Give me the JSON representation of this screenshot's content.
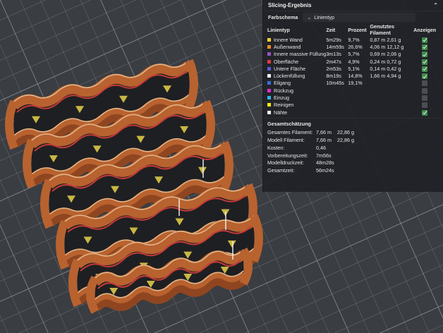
{
  "panel": {
    "title": "Slicing-Ergebnis",
    "color_scheme_label": "Farbschema",
    "color_scheme_value": "Linientyp",
    "headers": [
      "Linientyp",
      "Zeit",
      "Prozent",
      "Genutztes Filament",
      "Anzeigen"
    ],
    "rows": [
      {
        "name": "Innere Wand",
        "time": "5m29s",
        "percent": "9,7%",
        "len": "0,87 m",
        "weight": "2,61 g",
        "color": "#f2d22e",
        "visible": true
      },
      {
        "name": "Außenwand",
        "time": "14m59s",
        "percent": "26,6%",
        "len": "4,06 m",
        "weight": "12,12 g",
        "color": "#f28a2a",
        "visible": true
      },
      {
        "name": "Innere massive Füllung",
        "time": "3m13s",
        "percent": "5,7%",
        "len": "0,69 m",
        "weight": "2,06 g",
        "color": "#9a4fc9",
        "visible": true
      },
      {
        "name": "Oberfläche",
        "time": "2m47s",
        "percent": "4,9%",
        "len": "0,24 m",
        "weight": "0,72 g",
        "color": "#e33a3a",
        "visible": true
      },
      {
        "name": "Untere Fläche",
        "time": "2m53s",
        "percent": "5,1%",
        "len": "0,14 m",
        "weight": "0,42 g",
        "color": "#5a5ad8",
        "visible": true
      },
      {
        "name": "Lückenfüllung",
        "time": "8m19s",
        "percent": "14,8%",
        "len": "1,66 m",
        "weight": "4,94 g",
        "color": "#f2f2f2",
        "visible": true
      },
      {
        "name": "Eilgang",
        "time": "10m45s",
        "percent": "19,1%",
        "len": "",
        "weight": "",
        "color": "#3a6ee0",
        "visible": false
      },
      {
        "name": "Rückzug",
        "time": "",
        "percent": "",
        "len": "",
        "weight": "",
        "color": "#e22ad8",
        "visible": false
      },
      {
        "name": "Einzug",
        "time": "",
        "percent": "",
        "len": "",
        "weight": "",
        "color": "#2ab8e6",
        "visible": false
      },
      {
        "name": "Reinigen",
        "time": "",
        "percent": "",
        "len": "",
        "weight": "",
        "color": "#f5f00e",
        "visible": false
      },
      {
        "name": "Nähte",
        "time": "",
        "percent": "",
        "len": "",
        "weight": "",
        "color": "#f2f2f2",
        "visible": true
      }
    ],
    "summary_title": "Gesamtschätzung",
    "summary": [
      {
        "key": "Gesamtes Filament:",
        "v1": "7,66 m",
        "v2": "22,86 g"
      },
      {
        "key": "Modell Filament:",
        "v1": "7,66 m",
        "v2": "22,86 g"
      },
      {
        "key": "Kosten:",
        "v1": "0,46",
        "v2": ""
      },
      {
        "key": "Vorbereitungszeit:",
        "v1": "7m56s",
        "v2": ""
      },
      {
        "key": "Modelldruckzeit:",
        "v1": "48m28s",
        "v2": ""
      },
      {
        "key": "Gesamtzeit:",
        "v1": "56m24s",
        "v2": ""
      }
    ]
  },
  "viewport": {
    "background": "#3a3d42",
    "grid": "#6d7178",
    "wall": "#b8622f",
    "wall_dark": "#8f4620",
    "top_edge": "#e2b486",
    "gap_fill": "#e8d24a",
    "floor": "#1e1f22",
    "top_skin": "#c43a3a"
  }
}
